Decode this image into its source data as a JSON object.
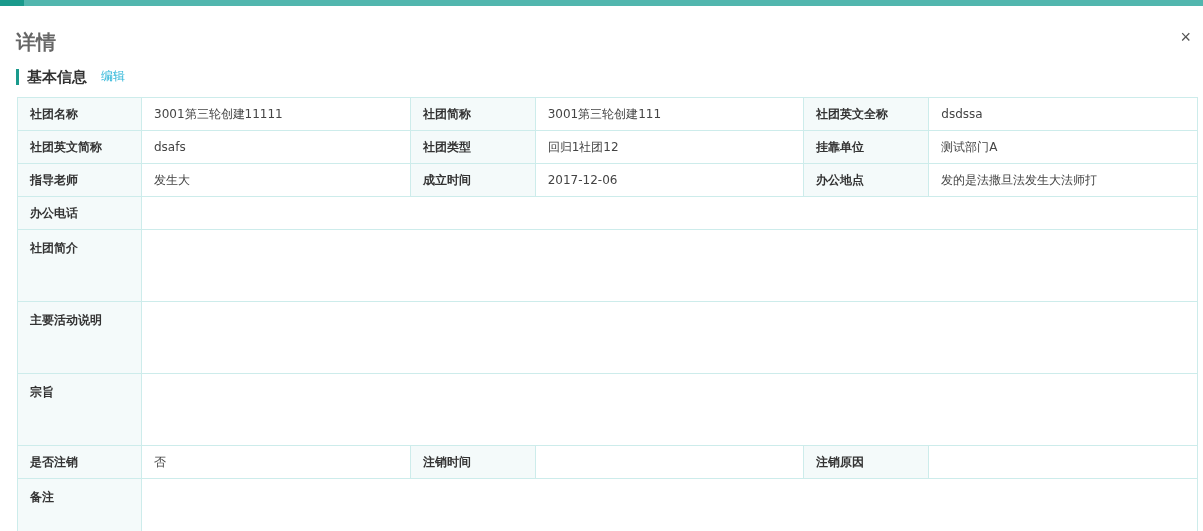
{
  "dialog": {
    "title": "详情",
    "close": "×"
  },
  "section": {
    "title": "基本信息",
    "action": "编辑"
  },
  "rows": [
    {
      "kind": "triple",
      "cells": [
        {
          "label": "社团名称",
          "value": "3001第三轮创建11111"
        },
        {
          "label": "社团简称",
          "value": "3001第三轮创建111"
        },
        {
          "label": "社团英文全称",
          "value": "dsdssa"
        }
      ]
    },
    {
      "kind": "triple",
      "cells": [
        {
          "label": "社团英文简称",
          "value": "dsafs"
        },
        {
          "label": "社团类型",
          "value": "回归1社团12"
        },
        {
          "label": "挂靠单位",
          "value": "测试部门A"
        }
      ]
    },
    {
      "kind": "triple",
      "cells": [
        {
          "label": "指导老师",
          "value": "发生大"
        },
        {
          "label": "成立时间",
          "value": "2017-12-06"
        },
        {
          "label": "办公地点",
          "value": "发的是法撒旦法发生大法师打"
        }
      ]
    },
    {
      "kind": "single",
      "cells": [
        {
          "label": "办公电话"
        }
      ]
    },
    {
      "kind": "tall",
      "cells": [
        {
          "label": "社团简介"
        }
      ]
    },
    {
      "kind": "tall",
      "cells": [
        {
          "label": "主要活动说明"
        }
      ]
    },
    {
      "kind": "tall",
      "cells": [
        {
          "label": "宗旨"
        }
      ]
    },
    {
      "kind": "triple",
      "cells": [
        {
          "label": "是否注销",
          "value": "否"
        },
        {
          "label": "注销时间"
        },
        {
          "label": "注销原因"
        }
      ]
    },
    {
      "kind": "tall",
      "cells": [
        {
          "label": "备注"
        }
      ]
    }
  ]
}
